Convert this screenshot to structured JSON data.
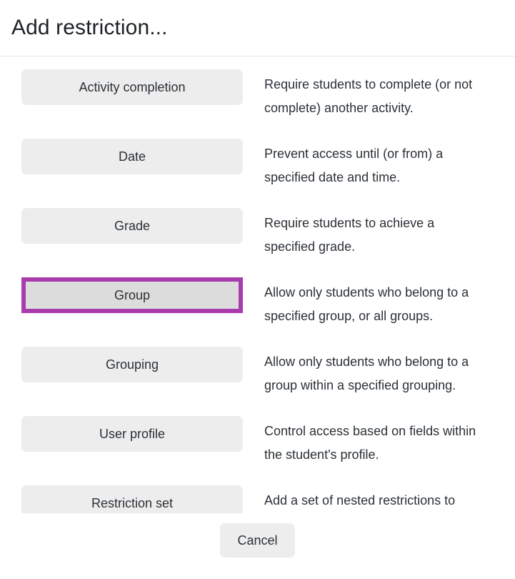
{
  "dialog": {
    "title": "Add restriction...",
    "accent_color": "#a83cad",
    "button_bg": "#ededed",
    "button_bg_focused": "#dcdcdc",
    "text_color": "#2b3137",
    "divider_color": "#e6e6e6",
    "focused_option": "Group"
  },
  "options": [
    {
      "label": "Activity completion",
      "description": "Require students to complete (or not complete) another activity.",
      "focused": false
    },
    {
      "label": "Date",
      "description": "Prevent access until (or from) a specified date and time.",
      "focused": false
    },
    {
      "label": "Grade",
      "description": "Require students to achieve a specified grade.",
      "focused": false
    },
    {
      "label": "Group",
      "description": "Allow only students who belong to a specified group, or all groups.",
      "focused": true
    },
    {
      "label": "Grouping",
      "description": "Allow only students who belong to a group within a specified grouping.",
      "focused": false
    },
    {
      "label": "User profile",
      "description": "Control access based on fields within the student's profile.",
      "focused": false
    },
    {
      "label": "Restriction set",
      "description": "Add a set of nested restrictions to apply complex logic.",
      "focused": false
    }
  ],
  "footer": {
    "cancel_label": "Cancel"
  }
}
